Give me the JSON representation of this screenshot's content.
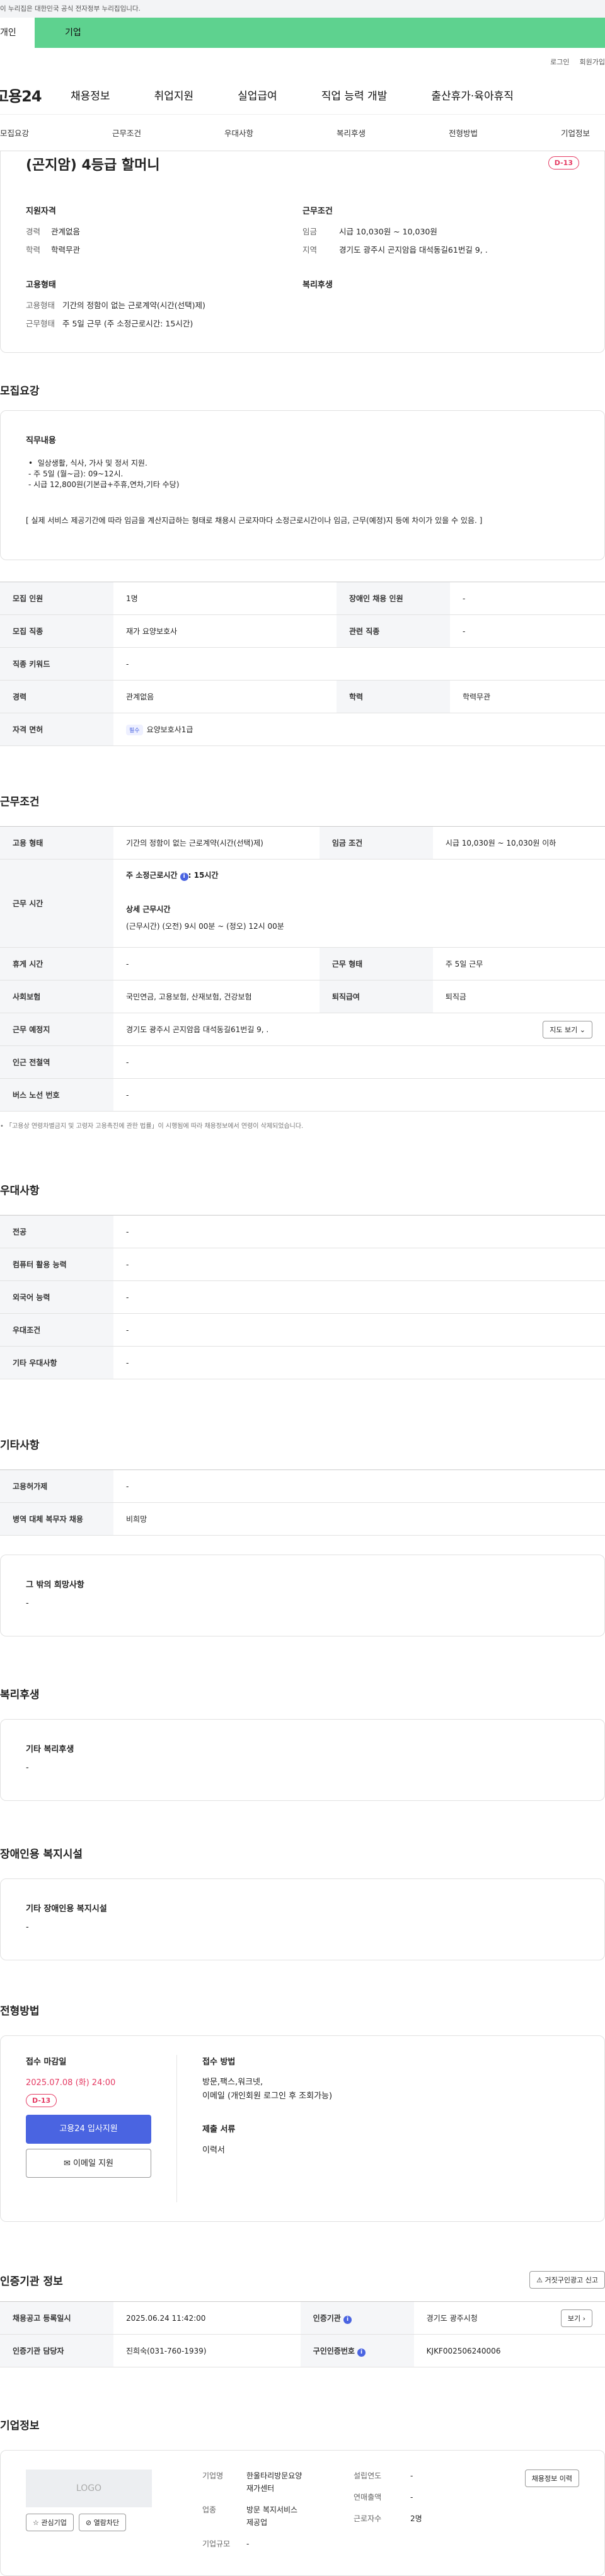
{
  "gov_notice": "이 누리집은 대한민국 공식 전자정부 누리집입니다.",
  "top_tabs": {
    "personal": "개인",
    "company": "기업"
  },
  "util": {
    "login": "로그인",
    "join": "회원가입"
  },
  "gnb": {
    "logo": "고용24",
    "menus": [
      "채용정보",
      "취업지원",
      "실업급여",
      "직업 능력 개발",
      "출산휴가·육아휴직"
    ]
  },
  "subnav": [
    "모집요강",
    "근무조건",
    "우대사항",
    "복리후생",
    "전형방법",
    "기업정보"
  ],
  "summary": {
    "title": "(곤지암) 4등급 할머니",
    "dday": "D-13",
    "qual_title": "지원자격",
    "career_k": "경력",
    "career_v": "관계없음",
    "edu_k": "학력",
    "edu_v": "학력무관",
    "cond_title": "근무조건",
    "pay_k": "임금",
    "pay_v": "시급 10,030원 ~ 10,030원",
    "area_k": "지역",
    "area_v": "경기도 광주시 곤지암읍 대석동길61번길 9, .",
    "emp_title": "고용형태",
    "etype_k": "고용형태",
    "etype_v": "기간의 정함이 없는 근로계약(시간(선택)제)",
    "work_k": "근무형태",
    "work_v": "주 5일 근무 (주 소정근로시간: 15시간)",
    "welfare_title": "복리후생"
  },
  "recruit": {
    "section": "모집요강",
    "duty_title": "직무내용",
    "duty_lines": [
      "일상생활, 식사, 가사 및 정서 지원.",
      "- 주 5일 (월~금): 09~12시.",
      "- 시급 12,800원(기본급+주휴,연차,기타 수당)"
    ],
    "duty_note": "[ 실제 서비스 제공기간에 따라 임금을 계산지급하는 형태로 채용시 근로자마다 소정근로시간이나 임금, 근무(예정)지 등에 차이가 있을 수 있음. ]",
    "rows": {
      "count_k": "모집 인원",
      "count_v": "1명",
      "dis_k": "장애인 채용 인원",
      "dis_v": "-",
      "job_k": "모집 직종",
      "job_v": "재가 요양보호사",
      "rel_k": "관련 직종",
      "rel_v": "-",
      "kw_k": "직종 키워드",
      "kw_v": "-",
      "car_k": "경력",
      "car_v": "관계없음",
      "edu_k": "학력",
      "edu_v": "학력무관",
      "lic_k": "자격 면허",
      "lic_chip": "필수",
      "lic_v": "요양보호사1급"
    }
  },
  "conditions": {
    "section": "근무조건",
    "type_k": "고용 형태",
    "type_v": "기간의 정함이 없는 근로계약(시간(선택)제)",
    "pay_k": "임금 조건",
    "pay_v": "시급 10,030원 ~ 10,030원 이하",
    "hours_k": "근무 시간",
    "weekly": "주 소정근로시간",
    "weekly_v": ": 15시간",
    "detail_title": "상세 근무시간",
    "detail_v": "(근무시간) (오전) 9시 00분 ~ (정오) 12시 00분",
    "rest_k": "휴게 시간",
    "rest_v": "-",
    "form_k": "근무 형태",
    "form_v": "주 5일 근무",
    "ins_k": "사회보험",
    "ins_v": "국민연금, 고용보험, 산재보험, 건강보험",
    "ret_k": "퇴직급여",
    "ret_v": "퇴직금",
    "place_k": "근무 예정지",
    "place_v": "경기도 광주시 곤지암읍 대석동길61번길 9, .",
    "map_btn": "지도 보기",
    "subway_k": "인근 전철역",
    "subway_v": "-",
    "bus_k": "버스 노선 번호",
    "bus_v": "-",
    "note": "「고용상 연령차별금지 및 고령자 고용촉진에 관한 법률」이 시행됨에 따라 채용정보에서 연령이 삭제되었습니다."
  },
  "pref": {
    "section": "우대사항",
    "rows": [
      [
        "전공",
        "-"
      ],
      [
        "컴퓨터 활용 능력",
        "-"
      ],
      [
        "외국어 능력",
        "-"
      ],
      [
        "우대조건",
        "-"
      ],
      [
        "기타 우대사항",
        "-"
      ]
    ]
  },
  "etc": {
    "section": "기타사항",
    "rows": [
      [
        "고용허가제",
        "-"
      ],
      [
        "병역 대체 복무자 채용",
        "비희망"
      ]
    ],
    "box_title": "그 밖의 희망사항",
    "box_v": "-"
  },
  "welfare": {
    "section": "복리후생",
    "box_title": "기타 복리후생",
    "box_v": "-"
  },
  "disfac": {
    "section": "장애인용 복지시설",
    "box_title": "기타 장애인용 복지시설",
    "box_v": "-"
  },
  "process": {
    "section": "전형방법",
    "deadline_title": "접수 마감일",
    "deadline_v": "2025.07.08 (화) 24:00",
    "dday": "D-13",
    "apply_btn": "고용24 입사지원",
    "email_btn": "이메일 지원",
    "method_title": "접수 방법",
    "method_v1": "방문,팩스,워크넷,",
    "method_v2": "이메일 (개인회원 로그인 후 조회가능)",
    "docs_title": "제출 서류",
    "docs_v": "이력서"
  },
  "auth": {
    "section": "인증기관 정보",
    "report_btn": "거짓구인광고 신고",
    "reg_k": "채용공고 등록일시",
    "reg_v": "2025.06.24 11:42:00",
    "org_k": "인증기관",
    "org_v": "경기도 광주시청",
    "more_btn": "보기",
    "mgr_k": "인증기관 담당자",
    "mgr_v": "진희숙(031-760-1939)",
    "num_k": "구인인증번호",
    "num_v": "KJKF002506240006"
  },
  "company": {
    "section": "기업정보",
    "logo": "LOGO",
    "fav_btn": "관심기업",
    "block_btn": "열람차단",
    "name_k": "기업명",
    "name_v1": "한울타리방문요양",
    "name_v2": "재가센터",
    "ind_k": "업종",
    "ind_v1": "방문 복지서비스",
    "ind_v2": "제공업",
    "scale_k": "기업규모",
    "scale_v": "-",
    "year_k": "설립연도",
    "year_v": "-",
    "sales_k": "연매출액",
    "sales_v": "-",
    "emp_k": "근로자수",
    "emp_v": "2명",
    "jobs_btn": "채용정보 이력"
  }
}
